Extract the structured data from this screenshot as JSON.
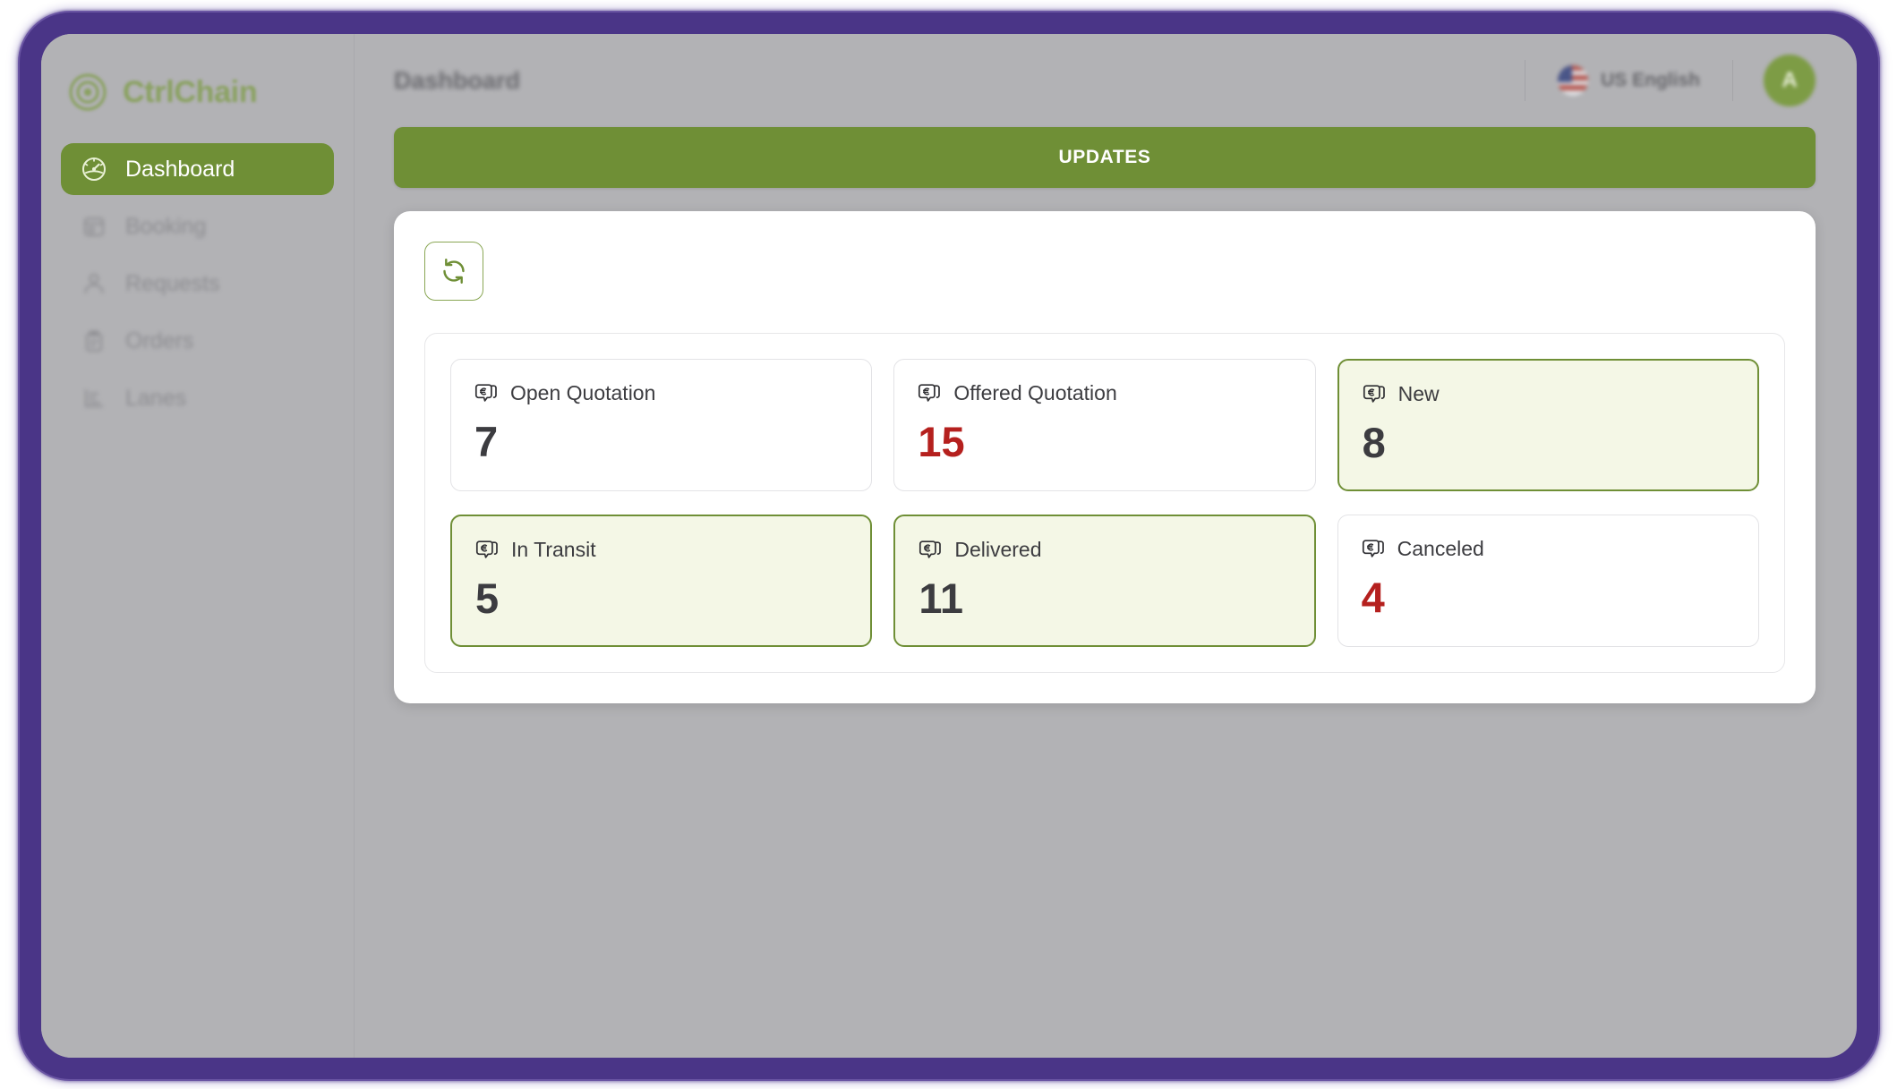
{
  "brand": {
    "name": "CtrlChain",
    "icon": "target-spiral-icon"
  },
  "sidebar": {
    "items": [
      {
        "label": "Dashboard",
        "icon": "gauge-icon",
        "active": true
      },
      {
        "label": "Booking",
        "icon": "booking-icon",
        "active": false
      },
      {
        "label": "Requests",
        "icon": "requests-icon",
        "active": false
      },
      {
        "label": "Orders",
        "icon": "orders-icon",
        "active": false
      },
      {
        "label": "Lanes",
        "icon": "lanes-icon",
        "active": false
      }
    ]
  },
  "topbar": {
    "title": "Dashboard",
    "language": {
      "label": "US English",
      "icon": "us-flag-icon"
    },
    "avatar": {
      "initial": "A"
    }
  },
  "banner": {
    "label": "UPDATES"
  },
  "toolbar": {
    "refresh_icon": "refresh-icon"
  },
  "cards": [
    {
      "label": "Open Quotation",
      "value": "7",
      "icon": "euro-bubble-icon",
      "highlighted": false,
      "value_color": "dark"
    },
    {
      "label": "Offered Quotation",
      "value": "15",
      "icon": "euro-bubble-icon",
      "highlighted": false,
      "value_color": "red"
    },
    {
      "label": "New",
      "value": "8",
      "icon": "euro-bubble-icon",
      "highlighted": true,
      "value_color": "dark"
    },
    {
      "label": "In Transit",
      "value": "5",
      "icon": "euro-bubble-icon",
      "highlighted": true,
      "value_color": "dark"
    },
    {
      "label": "Delivered",
      "value": "11",
      "icon": "euro-bubble-icon",
      "highlighted": true,
      "value_color": "dark"
    },
    {
      "label": "Canceled",
      "value": "4",
      "icon": "euro-bubble-icon",
      "highlighted": false,
      "value_color": "red"
    }
  ],
  "colors": {
    "brand_green": "#6f8f36",
    "highlight_bg": "#f4f7e6",
    "alert_red": "#b5201e",
    "frame_purple": "#4a3587",
    "app_bg": "#b2b2b5"
  }
}
